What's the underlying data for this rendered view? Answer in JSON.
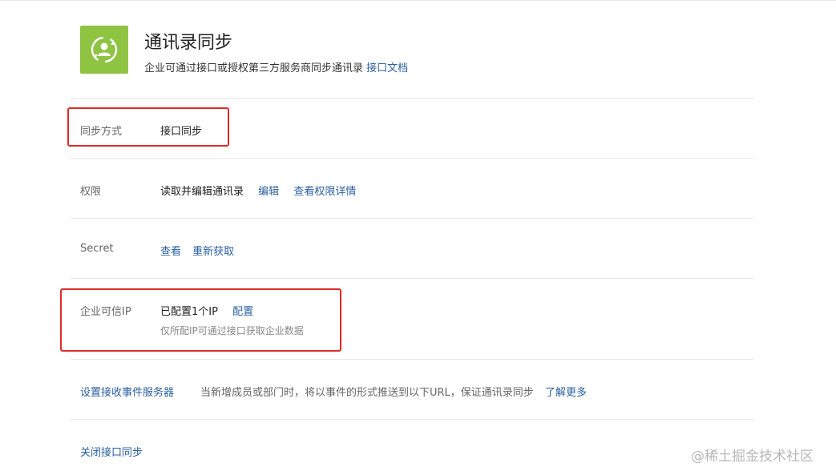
{
  "header": {
    "icon": "contacts-sync-icon",
    "icon_color": "#8fc342",
    "title": "通讯录同步",
    "description": "企业可通过接口或授权第三方服务商同步通讯录",
    "doc_link": "接口文档"
  },
  "rows": {
    "sync_method": {
      "label": "同步方式",
      "value": "接口同步"
    },
    "permission": {
      "label": "权限",
      "value": "读取并编辑通讯录",
      "edit": "编辑",
      "details": "查看权限详情"
    },
    "secret": {
      "label": "Secret",
      "view": "查看",
      "refetch": "重新获取"
    },
    "trusted_ip": {
      "label": "企业可信IP",
      "value": "已配置1个IP",
      "configure": "配置",
      "hint": "仅所配IP可通过接口获取企业数据"
    },
    "event_server": {
      "label": "设置接收事件服务器",
      "description": "当新增成员或部门时，将以事件的形式推送到以下URL，保证通讯录同步",
      "learn_more": "了解更多"
    },
    "close": {
      "label": "关闭接口同步"
    }
  },
  "colors": {
    "link": "#2b5fa0",
    "highlight": "#e02a2a"
  },
  "watermark": "@稀土掘金技术社区"
}
